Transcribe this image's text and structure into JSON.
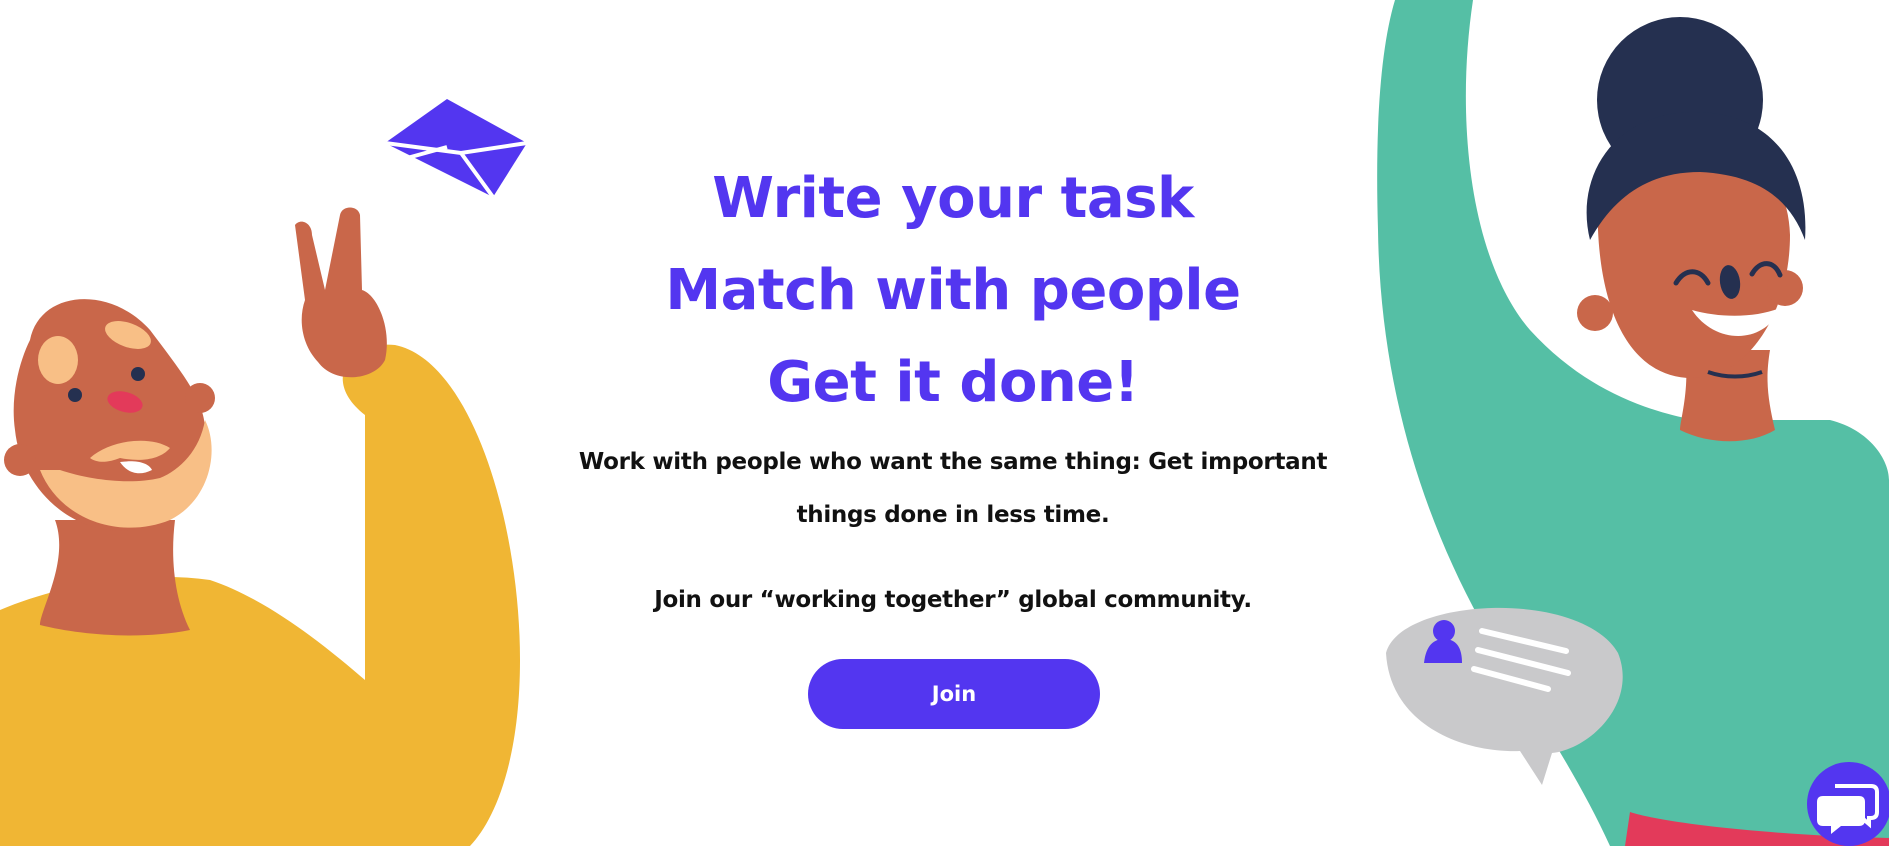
{
  "hero": {
    "headline_line1": "Write your task",
    "headline_line2": "Match with people",
    "headline_line3": "Get it done!",
    "subtitle_line1": "Work with people who want the same thing: Get important",
    "subtitle_line2": "things done in less time.",
    "community_text": "Join our “working together” global community.",
    "join_label": "Join"
  },
  "colors": {
    "brand": "#5336f0",
    "text": "#111111",
    "yellow_sweater": "#f0b634",
    "teal_sweater": "#55bfa5",
    "skin": "#c9674a",
    "hair_dark": "#253050",
    "bubble_grey": "#c9c9cb"
  },
  "icons": {
    "envelope": "envelope-icon",
    "chat_bubble": "chat-bubble-icon",
    "user": "user-icon",
    "chat_widget": "chat-widget-icon"
  }
}
